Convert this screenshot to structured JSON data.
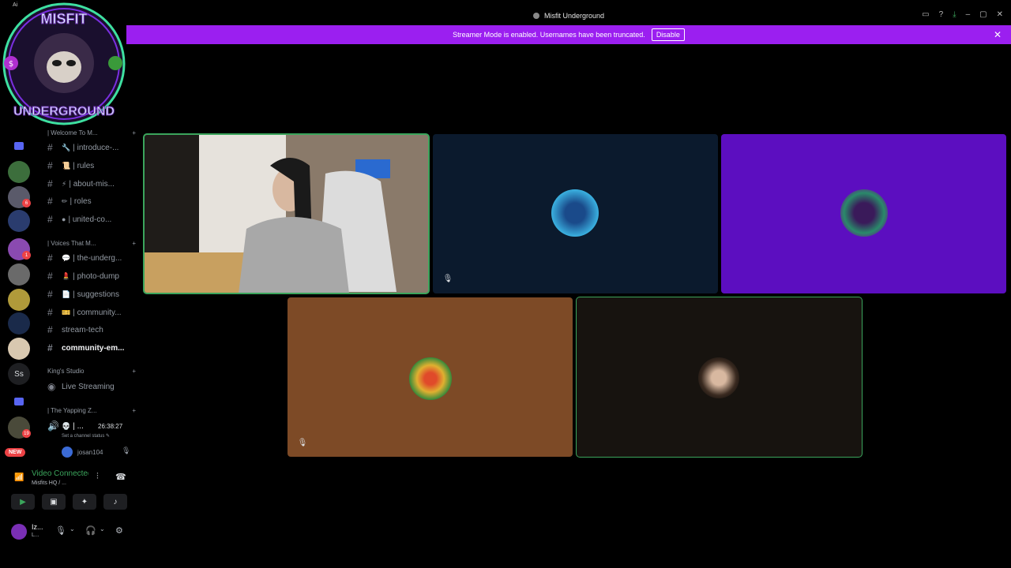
{
  "window": {
    "title": "Misfit Underground",
    "ai_label": "Ai"
  },
  "banner": {
    "message": "Streamer Mode is enabled. Usernames have been truncated.",
    "disable_label": "Disable",
    "color": "#9b1ff0"
  },
  "server_logo": {
    "top_text": "MISFIT",
    "bottom_text": "UNDERGROUND"
  },
  "rail": {
    "badges": [
      "6",
      "1",
      "19"
    ],
    "ss_label": "Ss",
    "new_label": "NEW"
  },
  "channels": {
    "categories": [
      {
        "label": "| Welcome To M..."
      },
      {
        "label": "| Voices That M..."
      },
      {
        "label": "King's Studio"
      },
      {
        "label": "| The Yapping Z..."
      }
    ],
    "items": [
      {
        "emoji_icon": "wrench-icon",
        "label": "| introduce-..."
      },
      {
        "emoji_icon": "scroll-icon",
        "label": "| rules"
      },
      {
        "emoji_icon": "bolt-icon",
        "label": "| about-mis..."
      },
      {
        "emoji_icon": "pencil-icon",
        "label": "| roles"
      },
      {
        "emoji_icon": "purple-circle-icon",
        "label": "| united-co..."
      },
      {
        "emoji_icon": "speech-bubble-icon",
        "label": "| the-underg..."
      },
      {
        "emoji_icon": "lipstick-icon",
        "label": "| photo-dump"
      },
      {
        "emoji_icon": "memo-icon",
        "label": "| suggestions"
      },
      {
        "emoji_icon": "ticket-icon",
        "label": "| community..."
      },
      {
        "emoji_icon": "",
        "label": "stream-tech"
      },
      {
        "emoji_icon": "",
        "label": "community-em..."
      }
    ],
    "live_streaming": "Live Streaming",
    "voice_channel_label": "| ...",
    "voice_timer": "26:38:27",
    "voice_status": "Set a channel status",
    "voice_user": "josan104"
  },
  "voice_panel": {
    "title": "Video Connected",
    "subtitle": "Misfits HQ / ..."
  },
  "user_panel": {
    "name": "Iz...",
    "status": "L..."
  },
  "tiles": {
    "speaking_color": "#3ba55c",
    "colors": [
      "#0b1a2d",
      "#5c0ec0",
      "#7d4a26",
      "#17130f"
    ]
  }
}
